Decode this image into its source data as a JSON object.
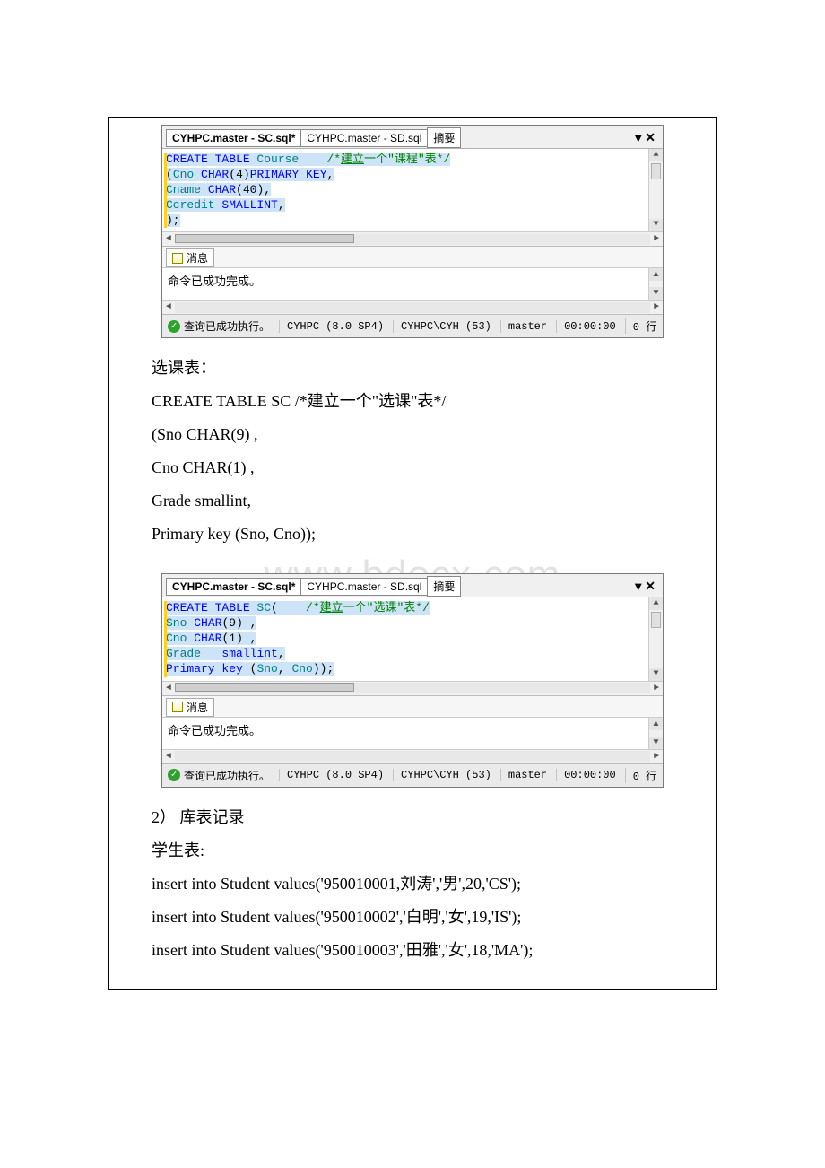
{
  "window1": {
    "tabs": [
      "CYHPC.master - SC.sql*",
      "CYHPC.master - SD.sql",
      "摘要"
    ],
    "code": [
      {
        "seg": [
          {
            "t": "CREATE TABLE ",
            "c": "blue sel"
          },
          {
            "t": "Course    ",
            "c": "teal sel"
          },
          {
            "t": "/*",
            "c": "green sel"
          },
          {
            "t": "建立",
            "c": "green sel",
            "u": true
          },
          {
            "t": "一个\"课程\"表*/",
            "c": "green sel"
          }
        ]
      },
      {
        "seg": [
          {
            "t": "(",
            "c": "sel"
          },
          {
            "t": "Cno ",
            "c": "teal sel"
          },
          {
            "t": "CHAR",
            "c": "blue sel"
          },
          {
            "t": "(",
            "c": "sel"
          },
          {
            "t": "4",
            "c": "sel"
          },
          {
            "t": ")",
            "c": "sel"
          },
          {
            "t": "PRIMARY KEY",
            "c": "blue sel"
          },
          {
            "t": ",",
            "c": "sel"
          }
        ]
      },
      {
        "seg": [
          {
            "t": "Cname ",
            "c": "teal sel"
          },
          {
            "t": "CHAR",
            "c": "blue sel"
          },
          {
            "t": "(",
            "c": "sel"
          },
          {
            "t": "40",
            "c": "sel"
          },
          {
            "t": ")",
            "c": "sel"
          },
          {
            "t": ",",
            "c": "sel"
          }
        ]
      },
      {
        "seg": [
          {
            "t": "Ccredit ",
            "c": "teal sel"
          },
          {
            "t": "SMALLINT",
            "c": "blue sel"
          },
          {
            "t": ",",
            "c": "sel"
          }
        ]
      },
      {
        "seg": [
          {
            "t": ");",
            "c": "sel"
          }
        ]
      }
    ],
    "msg_tab": "消息",
    "msg_text": "命令已成功完成。",
    "status": [
      "查询已成功执行。",
      "CYHPC (8.0 SP4)",
      "CYHPC\\CYH (53)",
      "master",
      "00:00:00",
      "0 行"
    ]
  },
  "mid_text": {
    "l1": "选课表：",
    "l2": "CREATE TABLE SC  /*建立一个\"选课\"表*/",
    "l3": "(Sno CHAR(9) ,",
    "l4": "Cno CHAR(1) ,",
    "l5": "Grade smallint,",
    "l6": "Primary key (Sno, Cno));"
  },
  "window2": {
    "tabs": [
      "CYHPC.master - SC.sql*",
      "CYHPC.master - SD.sql",
      "摘要"
    ],
    "code": [
      {
        "seg": [
          {
            "t": "CREATE TABLE ",
            "c": "blue sel"
          },
          {
            "t": "SC",
            "c": "teal sel"
          },
          {
            "t": "(    ",
            "c": "sel"
          },
          {
            "t": "/*",
            "c": "green sel"
          },
          {
            "t": "建立",
            "c": "green sel",
            "u": true
          },
          {
            "t": "一个\"选课\"表*/",
            "c": "green sel"
          }
        ]
      },
      {
        "seg": [
          {
            "t": "Sno ",
            "c": "teal sel"
          },
          {
            "t": "CHAR",
            "c": "blue sel"
          },
          {
            "t": "(",
            "c": "sel"
          },
          {
            "t": "9",
            "c": "sel"
          },
          {
            "t": ") ",
            "c": "sel"
          },
          {
            "t": ",",
            "c": "sel"
          }
        ]
      },
      {
        "seg": [
          {
            "t": "Cno ",
            "c": "teal sel"
          },
          {
            "t": "CHAR",
            "c": "blue sel"
          },
          {
            "t": "(",
            "c": "sel"
          },
          {
            "t": "1",
            "c": "sel"
          },
          {
            "t": ") ",
            "c": "sel"
          },
          {
            "t": ",",
            "c": "sel"
          }
        ]
      },
      {
        "seg": [
          {
            "t": "Grade   ",
            "c": "teal sel"
          },
          {
            "t": "smallint",
            "c": "blue sel"
          },
          {
            "t": ",",
            "c": "sel"
          }
        ]
      },
      {
        "seg": [
          {
            "t": "Primary key ",
            "c": "blue sel"
          },
          {
            "t": "(",
            "c": "sel"
          },
          {
            "t": "Sno",
            "c": "teal sel"
          },
          {
            "t": ", ",
            "c": "sel"
          },
          {
            "t": "Cno",
            "c": "teal sel"
          },
          {
            "t": "));",
            "c": "sel"
          }
        ]
      }
    ],
    "msg_tab": "消息",
    "msg_text": "命令已成功完成。",
    "status": [
      "查询已成功执行。",
      "CYHPC (8.0 SP4)",
      "CYHPC\\CYH (53)",
      "master",
      "00:00:00",
      "0 行"
    ]
  },
  "bottom_text": {
    "l1": "2） 库表记录",
    "l2": "学生表:",
    "l3": "insert into Student values('950010001,刘涛','男',20,'CS');",
    "l4": "insert into Student values('950010002','白明','女',19,'IS');",
    "l5": "insert into Student values('950010003','田雅','女',18,'MA');"
  },
  "watermark": "www.bdocx.com"
}
